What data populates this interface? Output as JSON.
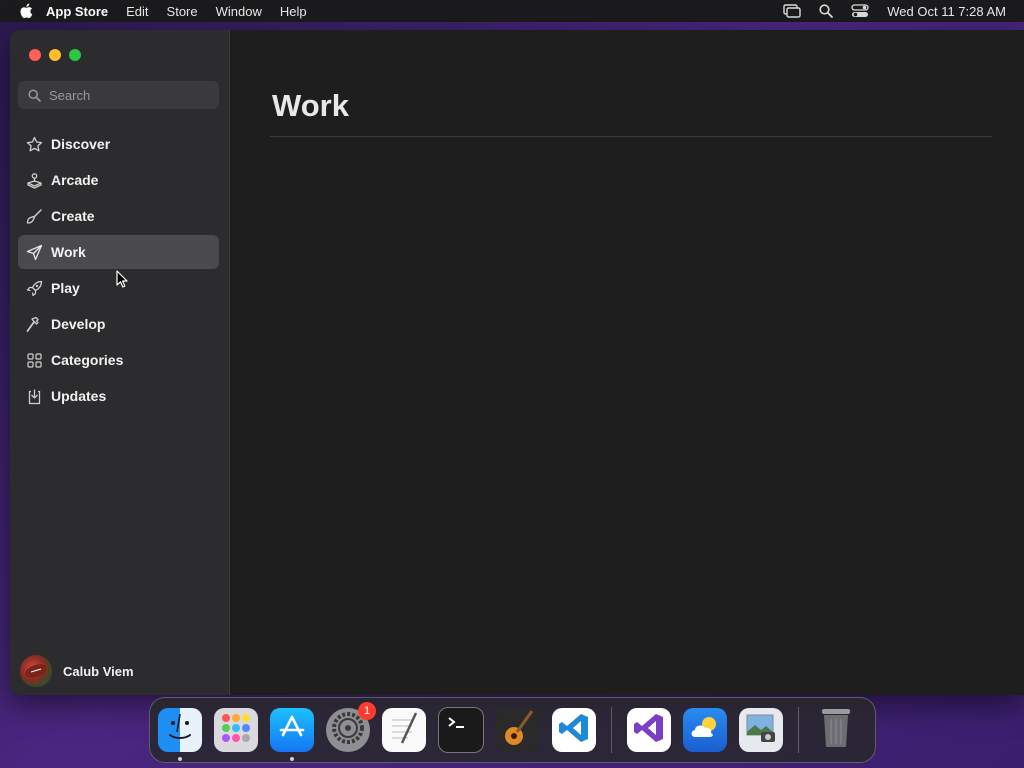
{
  "menubar": {
    "app_name": "App Store",
    "menus": [
      "Edit",
      "Store",
      "Window",
      "Help"
    ],
    "clock": "Wed Oct 11  7:28 AM",
    "status_icons": [
      "screen-mirroring-icon",
      "spotlight-search-icon",
      "control-center-icon"
    ]
  },
  "search": {
    "placeholder": "Search"
  },
  "sidebar": {
    "items": [
      {
        "label": "Discover",
        "icon": "star-icon",
        "selected": false
      },
      {
        "label": "Arcade",
        "icon": "joystick-icon",
        "selected": false
      },
      {
        "label": "Create",
        "icon": "paintbrush-icon",
        "selected": false
      },
      {
        "label": "Work",
        "icon": "paperplane-icon",
        "selected": true
      },
      {
        "label": "Play",
        "icon": "rocket-icon",
        "selected": false
      },
      {
        "label": "Develop",
        "icon": "hammer-icon",
        "selected": false
      },
      {
        "label": "Categories",
        "icon": "grid-icon",
        "selected": false
      },
      {
        "label": "Updates",
        "icon": "download-icon",
        "selected": false
      }
    ]
  },
  "profile": {
    "name": "Calub Viem"
  },
  "main": {
    "title": "Work"
  },
  "dock": {
    "apps": [
      {
        "name": "Finder",
        "icon": "finder-icon",
        "running": true
      },
      {
        "name": "Launchpad",
        "icon": "launchpad-icon",
        "running": false
      },
      {
        "name": "App Store",
        "icon": "app-store-icon",
        "running": true
      },
      {
        "name": "System Settings",
        "icon": "settings-gear-icon",
        "running": false,
        "badge": "1"
      },
      {
        "name": "TextEdit",
        "icon": "textedit-icon",
        "running": false
      },
      {
        "name": "Terminal",
        "icon": "terminal-icon",
        "running": false
      },
      {
        "name": "GarageBand",
        "icon": "guitar-icon",
        "running": false
      },
      {
        "name": "Visual Studio Code",
        "icon": "vscode-icon",
        "running": false
      },
      {
        "name": "Visual Studio",
        "icon": "visual-studio-icon",
        "running": false
      },
      {
        "name": "Weather",
        "icon": "weather-icon",
        "running": false
      },
      {
        "name": "Preview",
        "icon": "preview-icon",
        "running": false
      },
      {
        "name": "Trash",
        "icon": "trash-icon",
        "running": false
      }
    ]
  },
  "colors": {
    "selected_bg": "#4a4a4d",
    "sidebar_bg": "#2c2c2e",
    "main_bg": "#1e1e1e",
    "badge_red": "#ff3b30"
  }
}
